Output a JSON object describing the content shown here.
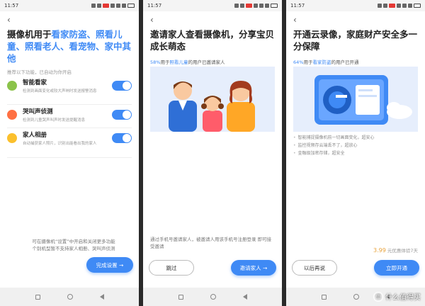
{
  "status_bar": {
    "time": "11:57"
  },
  "screen1": {
    "title_plain1": "摄像机用于",
    "title_hl1": "看家防盗、照看儿童、照看老人、看宠物、家中其他",
    "subtitle": "推荐以下功能，已自动为你开启",
    "features": [
      {
        "name": "智能看家",
        "desc": "检测到画面变化或较大声响时发送报警消息",
        "icon_color": "#8bc34a"
      },
      {
        "name": "哭叫声侦测",
        "desc": "检测到儿童哭声叫声时发送提醒消息",
        "icon_color": "#ff7043"
      },
      {
        "name": "家人相册",
        "desc": "自动捕获家人照片，识别出能看出我的家人",
        "icon_color": "#fbc02d"
      }
    ],
    "note": "可在摄像机“设置”中开启和关闭更多功能\n个别机型暂不支持家人相册、哭叫声侦测",
    "done_button": "完成设置 →"
  },
  "screen2": {
    "title": "邀请家人查看摄像机，分享宝贝成长萌态",
    "stat_pct": "58%",
    "stat_text1": "用于",
    "stat_hl": "照看儿童",
    "stat_text2": "的用户已邀请家人",
    "note": "通过手机号邀请家人，被邀请人用该手机号注册登录 即可接受邀请",
    "skip_button": "跳过",
    "invite_button": "邀请家人 →"
  },
  "screen3": {
    "title": "开通云录像，家庭财产安全多一分保障",
    "stat_pct": "64%",
    "stat_text1": "用于",
    "stat_hl": "看家防盗",
    "stat_text2": "的用户已开通",
    "bullets": [
      "智能捕捉摄像机前一切画面变化，超安心",
      "监控视频存云端丢不了，超放心",
      "金融级加密存储，超安全"
    ],
    "price_amount": "3.99",
    "price_text": " 元优惠体验7天",
    "later_button": "以后再说",
    "open_button": "立即开通"
  },
  "watermark": {
    "badge": "值",
    "text": "什么值得买"
  },
  "colors": {
    "accent": "#3f8af5",
    "price": "#e8a23a"
  }
}
